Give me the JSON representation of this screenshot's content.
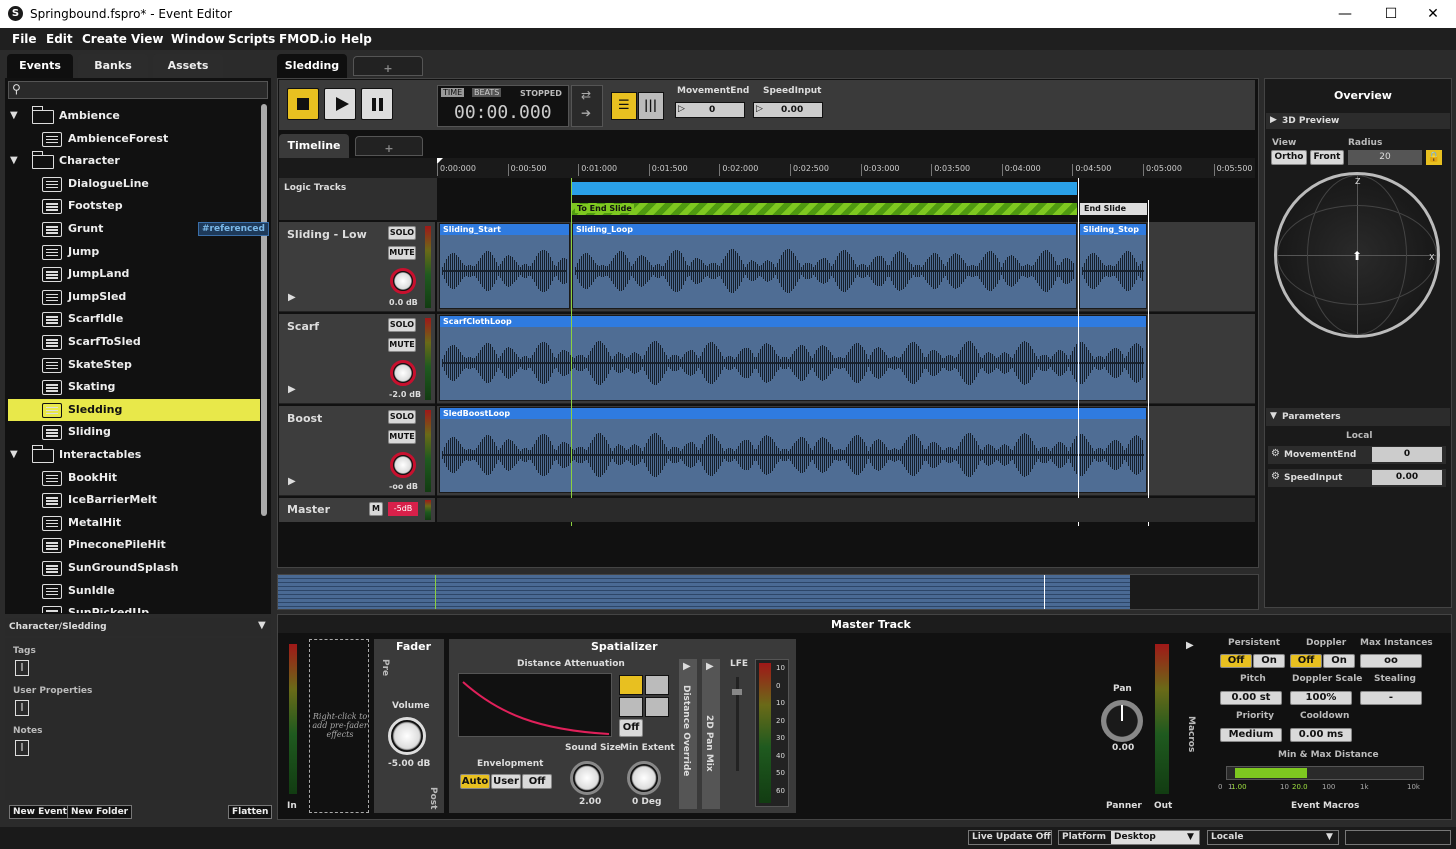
{
  "window": {
    "title": "Springbound.fspro* - Event Editor",
    "min": "—",
    "max": "☐",
    "close": "✕"
  },
  "menu": [
    "File",
    "Edit",
    "Create",
    "View",
    "Window",
    "Scripts",
    "FMOD.io",
    "Help"
  ],
  "browser": {
    "tabs": [
      "Events",
      "Banks",
      "Assets"
    ],
    "search_placeholder": "",
    "items": [
      {
        "label": "Ambience",
        "type": "folder",
        "level": 0
      },
      {
        "label": "AmbienceForest",
        "type": "event",
        "level": 1
      },
      {
        "label": "Character",
        "type": "folder",
        "level": 0
      },
      {
        "label": "DialogueLine",
        "type": "event",
        "level": 1
      },
      {
        "label": "Footstep",
        "type": "event",
        "level": 1
      },
      {
        "label": "Grunt",
        "type": "event",
        "level": 1,
        "badge": "#referenced"
      },
      {
        "label": "Jump",
        "type": "event",
        "level": 1
      },
      {
        "label": "JumpLand",
        "type": "event",
        "level": 1
      },
      {
        "label": "JumpSled",
        "type": "event",
        "level": 1
      },
      {
        "label": "ScarfIdle",
        "type": "event",
        "level": 1
      },
      {
        "label": "ScarfToSled",
        "type": "event",
        "level": 1
      },
      {
        "label": "SkateStep",
        "type": "event",
        "level": 1
      },
      {
        "label": "Skating",
        "type": "event",
        "level": 1
      },
      {
        "label": "Sledding",
        "type": "event",
        "level": 1,
        "selected": true
      },
      {
        "label": "Sliding",
        "type": "event",
        "level": 1
      },
      {
        "label": "Interactables",
        "type": "folder",
        "level": 0
      },
      {
        "label": "BookHit",
        "type": "event",
        "level": 1
      },
      {
        "label": "IceBarrierMelt",
        "type": "event",
        "level": 1
      },
      {
        "label": "MetalHit",
        "type": "event",
        "level": 1
      },
      {
        "label": "PineconePileHit",
        "type": "event",
        "level": 1
      },
      {
        "label": "SunGroundSplash",
        "type": "event",
        "level": 1
      },
      {
        "label": "SunIdle",
        "type": "event",
        "level": 1
      },
      {
        "label": "SunPickedUp",
        "type": "event",
        "level": 1
      }
    ],
    "path": "Character/Sledding",
    "tags_label": "Tags",
    "user_props_label": "User Properties",
    "notes_label": "Notes",
    "new_event": "New Event",
    "new_folder": "New Folder",
    "flatten": "Flatten"
  },
  "editor": {
    "tab": "Sledding",
    "add_tab": "+",
    "time_label": "TIME",
    "beats_label": "BEATS",
    "state": "STOPPED",
    "time": "00:00.000",
    "params": [
      {
        "name": "MovementEnd",
        "value": "0"
      },
      {
        "name": "SpeedInput",
        "value": "0.00"
      }
    ],
    "timeline_tab": "Timeline",
    "ruler": [
      "0:00:000",
      "0:00:500",
      "0:01:000",
      "0:01:500",
      "0:02:000",
      "0:02:500",
      "0:03:000",
      "0:03:500",
      "0:04:000",
      "0:04:500",
      "0:05:000",
      "0:05:500"
    ],
    "logic_tracks": "Logic Tracks",
    "loop_region": "To End Slide",
    "end_marker": "End Slide",
    "tracks": [
      {
        "name": "Sliding - Low",
        "db": "0.0 dB",
        "regions": [
          "Sliding_Start",
          "Sliding_Loop",
          "Sliding_Stop"
        ]
      },
      {
        "name": "Scarf",
        "db": "-2.0 dB",
        "regions": [
          "ScarfClothLoop"
        ]
      },
      {
        "name": "Boost",
        "db": "-oo dB",
        "regions": [
          "SledBoostLoop"
        ]
      }
    ],
    "solo": "SOLO",
    "mute": "MUTE",
    "master": "Master",
    "m": "M",
    "master_db": "-5dB"
  },
  "overview": {
    "title": "Overview",
    "preview": "3D Preview",
    "view": "View",
    "radius": "Radius",
    "ortho": "Ortho",
    "front": "Front",
    "radius_value": "20",
    "z": "Z",
    "x": "X",
    "parameters": "Parameters",
    "local": "Local",
    "params": [
      {
        "name": "MovementEnd",
        "value": "0"
      },
      {
        "name": "SpeedInput",
        "value": "0.00"
      }
    ]
  },
  "master_track": {
    "title": "Master Track",
    "in": "In",
    "out": "Out",
    "fx_hint": "Right-click to add pre-fader effects",
    "fader": "Fader",
    "pre": "Pre",
    "post": "Post",
    "volume": "Volume",
    "volume_value": "-5.00 dB",
    "spatializer": "Spatializer",
    "dist_att": "Distance Attenuation",
    "off": "Off",
    "envelopment": "Envelopment",
    "env_opts": [
      "Auto",
      "User",
      "Off"
    ],
    "sound_size": "Sound Size",
    "sound_size_value": "2.00",
    "min_extent": "Min Extent",
    "min_extent_value": "0 Deg",
    "dist_override": "Distance Override",
    "pan_mix": "2D Pan Mix",
    "lfe": "LFE",
    "meter_ticks": [
      "10",
      "0",
      "10",
      "20",
      "30",
      "40",
      "50",
      "60"
    ],
    "pan": "Pan",
    "pan_value": "0.00",
    "panner": "Panner",
    "macros": "Macros",
    "persistent": "Persistent",
    "doppler": "Doppler",
    "max_instances": "Max Instances",
    "off_l": "Off",
    "on_l": "On",
    "max_val": "oo",
    "pitch": "Pitch",
    "pitch_val": "0.00 st",
    "doppler_scale": "Doppler Scale",
    "doppler_scale_val": "100%",
    "stealing": "Stealing",
    "stealing_val": "-",
    "priority": "Priority",
    "priority_val": "Medium",
    "cooldown": "Cooldown",
    "cooldown_val": "0.00 ms",
    "minmax": "Min & Max Distance",
    "scale": [
      "0",
      "1",
      "1.00",
      "10",
      "20.0",
      "100",
      "1k",
      "10k"
    ],
    "event_macros": "Event Macros"
  },
  "status": {
    "live_update": "Live Update Off",
    "platform": "Platform",
    "platform_val": "Desktop",
    "locale": "Locale"
  }
}
